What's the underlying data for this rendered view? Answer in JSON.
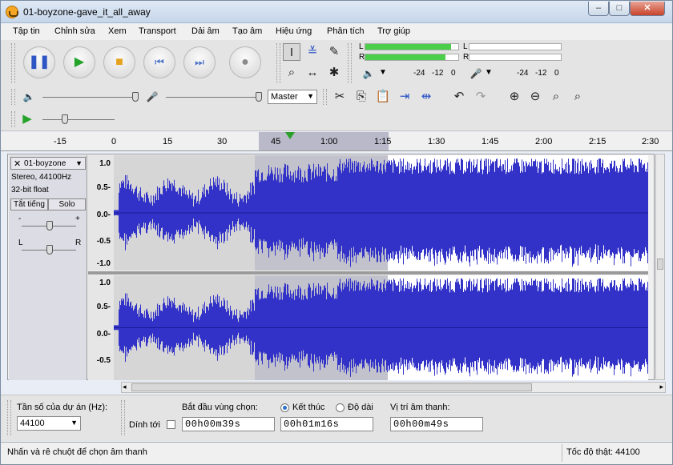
{
  "window": {
    "title": "01-boyzone-gave_it_all_away"
  },
  "menu": [
    "Tập tin",
    "Chỉnh sửa",
    "Xem",
    "Transport",
    "Dải âm",
    "Tạo âm",
    "Hiệu ứng",
    "Phân tích",
    "Trợ giúp"
  ],
  "meter": {
    "left_label": "L",
    "right_label": "R",
    "play_ticks": [
      "-24",
      "-12",
      "0"
    ],
    "rec_ticks": [
      "-24",
      "-12",
      "0"
    ],
    "levels": {
      "left": 0.92,
      "right": 0.86
    }
  },
  "mixer": {
    "output_select": "Master"
  },
  "ruler": {
    "ticks": [
      "-15",
      "0",
      "15",
      "30",
      "45",
      "1:00",
      "1:15",
      "1:30",
      "1:45",
      "2:00",
      "2:15",
      "2:30"
    ]
  },
  "track": {
    "name": "01-boyzone",
    "format": "Stereo, 44100Hz",
    "sample": "32-bit float",
    "mute_label": "Tắt tiếng",
    "solo_label": "Solo",
    "gain_minus": "-",
    "gain_plus": "+",
    "pan_left": "L",
    "pan_right": "R",
    "y_labels_top": [
      "1.0",
      "0.5-",
      "0.0-",
      "-0.5",
      "-1.0"
    ],
    "y_labels_bottom": [
      "1.0",
      "0.5-",
      "0.0-",
      "-0.5"
    ]
  },
  "selection_bar": {
    "rate_label": "Tần số của dự án (Hz):",
    "rate_value": "44100",
    "snap_label": "Dính tới",
    "start_label": "Bắt đầu vùng chọn:",
    "end_label": "Kết thúc",
    "length_label": "Độ dài",
    "pos_label": "Vị trí âm thanh:",
    "start_time": "00h00m39s",
    "end_time": "00h01m16s",
    "pos_time": "00h00m49s"
  },
  "status": {
    "left": "Nhấn và rê chuột để chọn âm thanh",
    "right": "Tốc độ thật: 44100"
  }
}
